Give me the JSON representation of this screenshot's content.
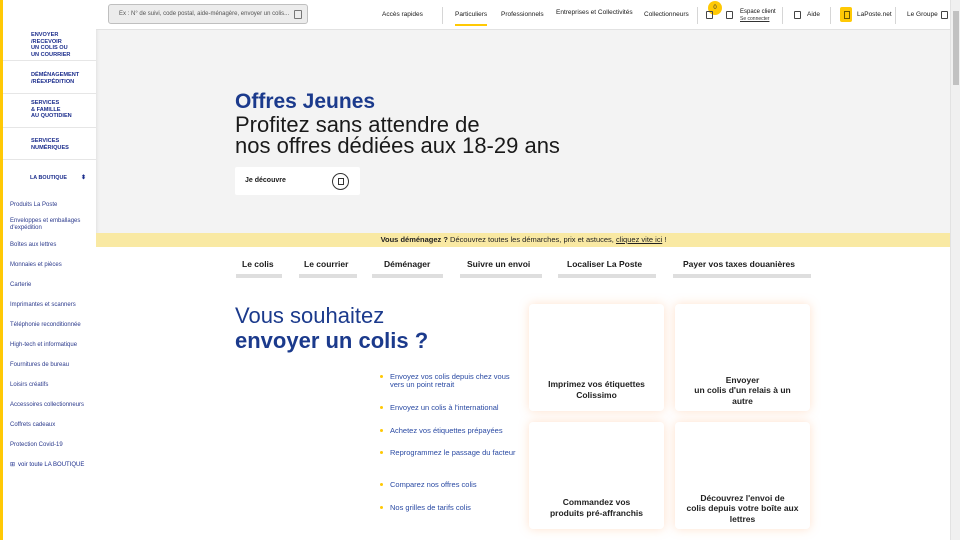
{
  "colors": {
    "accent": "#ffc905",
    "brand": "#1b3a8c",
    "banner": "#f9e9a3"
  },
  "sidebar": {
    "nav": [
      {
        "label": "ENVOYER\n/RECEVOIR\nUN COLIS OU\nUN COURRIER"
      },
      {
        "label": "DÉMÉNAGEMENT\n/RÉEXPÉDITION"
      },
      {
        "label": "SERVICES\n& FAMILLE\nAU QUOTIDIEN"
      },
      {
        "label": "SERVICES\nNUMÉRIQUES"
      }
    ],
    "boutique_title": "LA BOUTIQUE",
    "boutique_toggle_icon": "chevron-updown-icon",
    "boutique_items": [
      "Produits La Poste",
      "Enveloppes et emballages d'expédition",
      "Boîtes aux lettres",
      "Monnaies et pièces",
      "Carterie",
      "Imprimantes et scanners",
      "Téléphonie reconditionnée",
      "High-tech et informatique",
      "Fournitures de bureau",
      "Loisirs créatifs",
      "Accessoires collectionneurs",
      "Coffrets cadeaux",
      "Protection Covid-19"
    ],
    "see_all": "voir toute LA BOUTIQUE"
  },
  "header": {
    "search_placeholder": "Ex : N° de suivi, code postal, aide-ménagère, envoyer un colis...",
    "quick_access": "Accès rapides",
    "nav": [
      "Particuliers",
      "Professionnels",
      "Entreprises et Collectivités",
      "Collectionneurs"
    ],
    "active_nav": "Particuliers",
    "cart_count": "0",
    "espace_client": "Espace client",
    "se_connecter": "Se connecter",
    "aide": "Aide",
    "laposte_net": "LaPoste.net",
    "le_groupe": "Le Groupe"
  },
  "hero": {
    "kicker": "Offres Jeunes",
    "line1": "Profitez sans attendre de",
    "line2": "nos offres dédiées aux 18-29 ans",
    "cta": "Je découvre"
  },
  "banner": {
    "bold": "Vous déménagez ?",
    "text": " Découvrez toutes les démarches, prix et astuces, ",
    "link": "cliquez vite ici",
    "end": " !"
  },
  "tabs": [
    "Le colis",
    "Le courrier",
    "Déménager",
    "Suivre un envoi",
    "Localiser La Poste",
    "Payer vos taxes douanières"
  ],
  "send": {
    "title1": "Vous souhaitez",
    "title2": "envoyer un colis ?",
    "links": [
      "Envoyez vos colis depuis chez vous vers un point retrait",
      "Envoyez un colis à l'international",
      "Achetez vos étiquettes prépayées",
      "Reprogrammez le passage du facteur",
      "Comparez nos offres colis",
      "Nos grilles de tarifs colis"
    ]
  },
  "cards": [
    "Imprimez vos étiquettes\nColissimo",
    "Envoyer\nun colis d'un relais à un\nautre",
    "Commandez vos\nproduits pré-affranchis",
    "Découvrez l'envoi de\ncolis depuis votre boîte aux\nlettres"
  ]
}
